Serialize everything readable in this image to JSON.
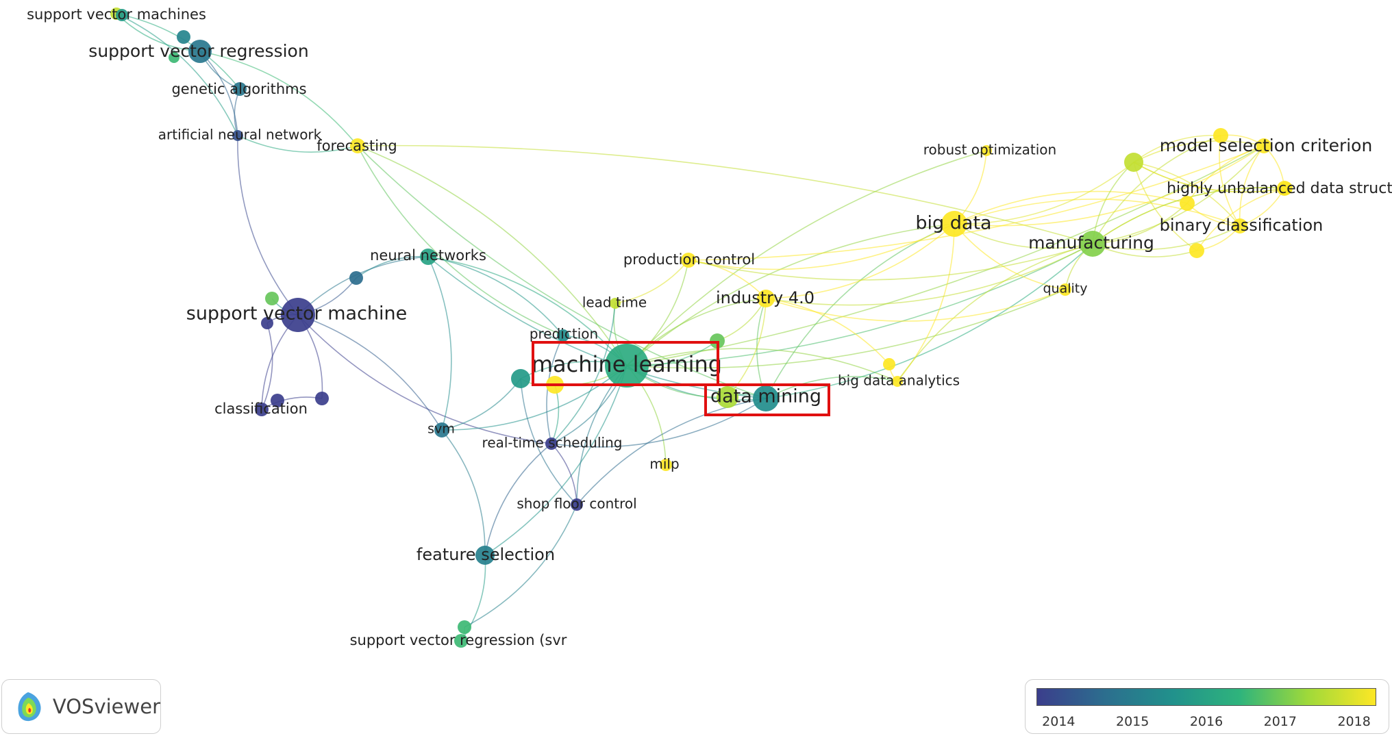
{
  "network": {
    "nodes": [
      {
        "id": "svms",
        "label": "support vector machines",
        "year": 2017.5
      },
      {
        "id": "svr",
        "label": "support vector regression",
        "year": 2015.0
      },
      {
        "id": "ga",
        "label": "genetic algorithms",
        "year": 2015.0
      },
      {
        "id": "ann",
        "label": "artificial neural network",
        "year": 2014.3
      },
      {
        "id": "forecasting",
        "label": "forecasting",
        "year": 2018.0
      },
      {
        "id": "robust",
        "label": "robust optimization",
        "year": 2018.0
      },
      {
        "id": "msc",
        "label": "model selection criterion",
        "year": 2018.0
      },
      {
        "id": "hud",
        "label": "highly unbalanced data structu",
        "year": 2018.0
      },
      {
        "id": "bigdata",
        "label": "big data",
        "year": 2018.0
      },
      {
        "id": "manufacturing",
        "label": "manufacturing",
        "year": 2017.0
      },
      {
        "id": "binary",
        "label": "binary classification",
        "year": 2018.0
      },
      {
        "id": "neural",
        "label": "neural networks",
        "year": 2016.0
      },
      {
        "id": "prodctrl",
        "label": "production control",
        "year": 2018.0
      },
      {
        "id": "quality",
        "label": "quality",
        "year": 2018.0
      },
      {
        "id": "svm_big",
        "label": "support vector machine",
        "year": 2014.0
      },
      {
        "id": "leadtime",
        "label": "lead time",
        "year": 2017.5
      },
      {
        "id": "industry",
        "label": "industry 4.0",
        "year": 2018.0
      },
      {
        "id": "prediction",
        "label": "prediction",
        "year": 2015.5
      },
      {
        "id": "ml",
        "label": "machine learning",
        "year": 2016.2
      },
      {
        "id": "dm",
        "label": "data mining",
        "year": 2015.5
      },
      {
        "id": "bda",
        "label": "big data analytics",
        "year": 2018.0
      },
      {
        "id": "classification",
        "label": "classification",
        "year": 2014.0
      },
      {
        "id": "svm_small",
        "label": "svm",
        "year": 2015.0
      },
      {
        "id": "rts",
        "label": "real-time scheduling",
        "year": 2014.0
      },
      {
        "id": "milp",
        "label": "milp",
        "year": 2018.0
      },
      {
        "id": "sfc",
        "label": "shop floor control",
        "year": 2014.0
      },
      {
        "id": "fs",
        "label": "feature selection",
        "year": 2015.2
      },
      {
        "id": "svr2",
        "label": "support vector regression (svr",
        "year": 2016.5
      },
      {
        "id": "u1",
        "label": "",
        "year": 2014.8
      },
      {
        "id": "u2",
        "label": "",
        "year": 2016.8
      },
      {
        "id": "u3",
        "label": "",
        "year": 2015.3
      },
      {
        "id": "u4",
        "label": "",
        "year": 2015.8
      },
      {
        "id": "u5",
        "label": "",
        "year": 2014.0
      },
      {
        "id": "u6",
        "label": "",
        "year": 2014.0
      },
      {
        "id": "u7",
        "label": "",
        "year": 2014.0
      },
      {
        "id": "u8",
        "label": "",
        "year": 2015.8
      },
      {
        "id": "u9",
        "label": "",
        "year": 2018.0
      },
      {
        "id": "u10",
        "label": "",
        "year": 2017.3
      },
      {
        "id": "u11",
        "label": "",
        "year": 2017.5
      },
      {
        "id": "u12",
        "label": "",
        "year": 2018.0
      },
      {
        "id": "u13",
        "label": "",
        "year": 2018.0
      },
      {
        "id": "u14",
        "label": "",
        "year": 2018.0
      },
      {
        "id": "u15",
        "label": "",
        "year": 2018.0
      },
      {
        "id": "u16",
        "label": "",
        "year": 2018.0
      },
      {
        "id": "u17",
        "label": "",
        "year": 2016.5
      },
      {
        "id": "u18",
        "label": "",
        "year": 2016.8
      },
      {
        "id": "u19",
        "label": "",
        "year": 2016.5
      }
    ],
    "edges": [
      [
        "svms",
        "svr"
      ],
      [
        "svms",
        "ga"
      ],
      [
        "svr",
        "ga"
      ],
      [
        "svr",
        "ann"
      ],
      [
        "ga",
        "ann"
      ],
      [
        "svms",
        "ann"
      ],
      [
        "ann",
        "svm_big"
      ],
      [
        "svr",
        "forecasting"
      ],
      [
        "ann",
        "forecasting"
      ],
      [
        "forecasting",
        "ml"
      ],
      [
        "forecasting",
        "dm"
      ],
      [
        "forecasting",
        "manufacturing"
      ],
      [
        "forecasting",
        "prediction"
      ],
      [
        "svm_big",
        "neural"
      ],
      [
        "svm_big",
        "classification"
      ],
      [
        "svm_big",
        "svm_small"
      ],
      [
        "svm_big",
        "u1"
      ],
      [
        "svm_big",
        "u2"
      ],
      [
        "svm_big",
        "u5"
      ],
      [
        "svm_big",
        "u6"
      ],
      [
        "u6",
        "classification"
      ],
      [
        "u5",
        "classification"
      ],
      [
        "svm_big",
        "rts"
      ],
      [
        "neural",
        "ml"
      ],
      [
        "neural",
        "u1"
      ],
      [
        "neural",
        "svm_small"
      ],
      [
        "neural",
        "dm"
      ],
      [
        "neural",
        "prediction"
      ],
      [
        "svm_small",
        "ml"
      ],
      [
        "svm_small",
        "fs"
      ],
      [
        "svm_small",
        "u8"
      ],
      [
        "fs",
        "svr2"
      ],
      [
        "fs",
        "ml"
      ],
      [
        "fs",
        "rts"
      ],
      [
        "ml",
        "dm"
      ],
      [
        "ml",
        "bigdata"
      ],
      [
        "ml",
        "manufacturing"
      ],
      [
        "ml",
        "industry"
      ],
      [
        "ml",
        "prodctrl"
      ],
      [
        "ml",
        "leadtime"
      ],
      [
        "ml",
        "prediction"
      ],
      [
        "ml",
        "rts"
      ],
      [
        "ml",
        "sfc"
      ],
      [
        "ml",
        "milp"
      ],
      [
        "ml",
        "u8"
      ],
      [
        "ml",
        "u9"
      ],
      [
        "ml",
        "u10"
      ],
      [
        "ml",
        "robust"
      ],
      [
        "ml",
        "quality"
      ],
      [
        "ml",
        "bda"
      ],
      [
        "ml",
        "msc"
      ],
      [
        "dm",
        "bigdata"
      ],
      [
        "dm",
        "manufacturing"
      ],
      [
        "dm",
        "industry"
      ],
      [
        "dm",
        "sfc"
      ],
      [
        "dm",
        "bda"
      ],
      [
        "dm",
        "u10"
      ],
      [
        "dm",
        "rts"
      ],
      [
        "bigdata",
        "manufacturing"
      ],
      [
        "bigdata",
        "industry"
      ],
      [
        "bigdata",
        "robust"
      ],
      [
        "bigdata",
        "prodctrl"
      ],
      [
        "bigdata",
        "quality"
      ],
      [
        "bigdata",
        "binary"
      ],
      [
        "bigdata",
        "msc"
      ],
      [
        "bigdata",
        "u12"
      ],
      [
        "bigdata",
        "u11"
      ],
      [
        "bigdata",
        "bda"
      ],
      [
        "manufacturing",
        "binary"
      ],
      [
        "manufacturing",
        "hud"
      ],
      [
        "manufacturing",
        "msc"
      ],
      [
        "manufacturing",
        "u11"
      ],
      [
        "manufacturing",
        "u12"
      ],
      [
        "manufacturing",
        "u13"
      ],
      [
        "manufacturing",
        "u14"
      ],
      [
        "manufacturing",
        "u15"
      ],
      [
        "manufacturing",
        "quality"
      ],
      [
        "manufacturing",
        "industry"
      ],
      [
        "manufacturing",
        "bda"
      ],
      [
        "u11",
        "msc"
      ],
      [
        "u11",
        "hud"
      ],
      [
        "u11",
        "binary"
      ],
      [
        "u11",
        "u14"
      ],
      [
        "u11",
        "u13"
      ],
      [
        "u11",
        "u15"
      ],
      [
        "msc",
        "hud"
      ],
      [
        "msc",
        "binary"
      ],
      [
        "hud",
        "binary"
      ],
      [
        "u13",
        "binary"
      ],
      [
        "u14",
        "hud"
      ],
      [
        "u15",
        "hud"
      ],
      [
        "u12",
        "msc"
      ],
      [
        "u12",
        "binary"
      ],
      [
        "u13",
        "msc"
      ],
      [
        "u14",
        "binary"
      ],
      [
        "prodctrl",
        "industry"
      ],
      [
        "prodctrl",
        "manufacturing"
      ],
      [
        "prodctrl",
        "leadtime"
      ],
      [
        "prodctrl",
        "msc"
      ],
      [
        "industry",
        "u10"
      ],
      [
        "industry",
        "quality"
      ],
      [
        "industry",
        "u16"
      ],
      [
        "u16",
        "bda"
      ],
      [
        "leadtime",
        "rts"
      ],
      [
        "prediction",
        "rts"
      ],
      [
        "u9",
        "rts"
      ],
      [
        "u8",
        "u9"
      ],
      [
        "rts",
        "sfc"
      ],
      [
        "u8",
        "sfc"
      ],
      [
        "u18",
        "ml"
      ],
      [
        "u18",
        "industry"
      ],
      [
        "u17",
        "svr2"
      ],
      [
        "u17",
        "sfc"
      ]
    ],
    "highlighted": [
      "ml",
      "dm"
    ]
  },
  "logo": {
    "text": "VOSviewer",
    "icon": "vosviewer-logo-icon"
  },
  "legend": {
    "min_year": 2013.7,
    "max_year": 2018.3,
    "ticks": [
      "2014",
      "2015",
      "2016",
      "2017",
      "2018"
    ],
    "tick_values": [
      2014,
      2015,
      2016,
      2017,
      2018
    ],
    "colormap": [
      "#3b3e8c",
      "#2c6e8e",
      "#21918c",
      "#2fb47c",
      "#9fd93a",
      "#fde725"
    ]
  },
  "colors": {
    "highlight_box": "#e01010"
  }
}
